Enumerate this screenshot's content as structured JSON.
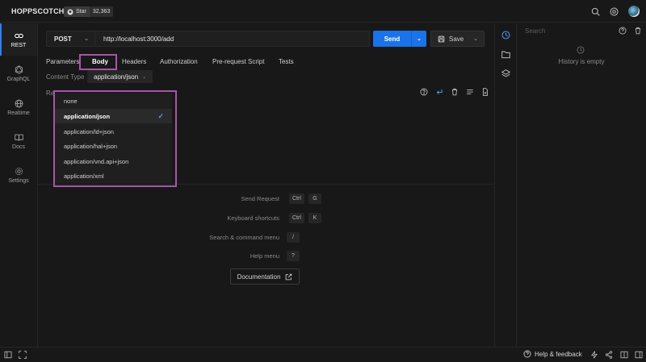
{
  "app": {
    "brand": "HOPPSCOTCH",
    "star_label": "Star",
    "star_count": "32,363"
  },
  "sidebar": {
    "items": [
      {
        "label": "REST",
        "icon": "link-icon",
        "active": true
      },
      {
        "label": "GraphQL",
        "icon": "graphql-icon"
      },
      {
        "label": "Realtime",
        "icon": "globe-icon"
      },
      {
        "label": "Docs",
        "icon": "book-icon"
      },
      {
        "label": "Settings",
        "icon": "gear-icon"
      }
    ]
  },
  "request": {
    "method": "POST",
    "url": "http://localhost:3000/add",
    "send_label": "Send",
    "save_label": "Save"
  },
  "tabs": [
    {
      "label": "Parameters"
    },
    {
      "label": "Body",
      "active": true
    },
    {
      "label": "Headers"
    },
    {
      "label": "Authorization"
    },
    {
      "label": "Pre-request Script"
    },
    {
      "label": "Tests"
    }
  ],
  "body": {
    "content_type_label": "Content Type",
    "content_type_value": "application/json",
    "raw_label": "Ra"
  },
  "content_type_menu": {
    "options": [
      "none",
      "application/json",
      "application/ld+json",
      "application/hal+json",
      "application/vnd.api+json",
      "application/xml"
    ],
    "selected": "application/json"
  },
  "shortcuts": [
    {
      "label": "Send Request",
      "keys": [
        "Ctrl",
        "G"
      ]
    },
    {
      "label": "Keyboard shortcuts",
      "keys": [
        "Ctrl",
        "K"
      ]
    },
    {
      "label": "Search & command menu",
      "keys": [
        "/"
      ]
    },
    {
      "label": "Help menu",
      "keys": [
        "?"
      ]
    }
  ],
  "documentation_label": "Documentation",
  "history": {
    "search_placeholder": "Search",
    "empty_text": "History is empty"
  },
  "footer": {
    "help_feedback": "Help & feedback"
  },
  "colors": {
    "accent": "#1a73e8",
    "highlight_box": "#a855a8",
    "background": "#181818"
  }
}
